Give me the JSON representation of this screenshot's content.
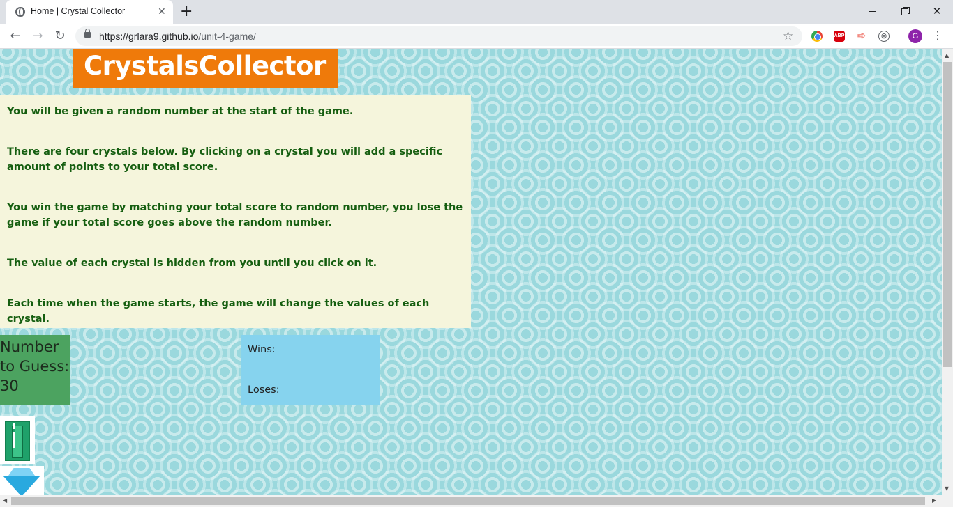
{
  "browser": {
    "tab_title": "Home | Crystal Collector",
    "tab_close": "✕",
    "new_tab": "+",
    "url_host": "https://grlara9.github.io",
    "url_path": "/unit-4-game/",
    "ext_abp": "ABP",
    "avatar_initial": "G"
  },
  "page": {
    "title": "CrystalsCollector",
    "instructions": [
      "You will be given a random number at the start of the game.",
      "There are four crystals below. By clicking on a crystal you will add a specific amount of points to your total score.",
      "You win the game by matching your total score to random number, you lose the game if your total score goes above the random number.",
      "The value of each crystal is hidden from you until you click on it.",
      "Each time when the game starts, the game will change the values of each crystal."
    ],
    "target_label_1": "Number",
    "target_label_2": "to Guess:",
    "target_value": "30",
    "wins_label": "Wins:",
    "loses_label": "Loses:"
  },
  "colors": {
    "banner": "#ef7a0a",
    "instructions_bg": "#f5f5dc",
    "instructions_text": "#155e10",
    "target_bg": "#4ca360",
    "score_bg": "#86d3ee",
    "page_bg": "#9ad8dd"
  },
  "icons": [
    "globe-icon",
    "close-icon",
    "plus-icon",
    "back-arrow-icon",
    "forward-arrow-icon",
    "reload-icon",
    "lock-icon",
    "star-icon",
    "more-vertical-icon",
    "green-crystal-icon",
    "blue-diamond-icon"
  ]
}
